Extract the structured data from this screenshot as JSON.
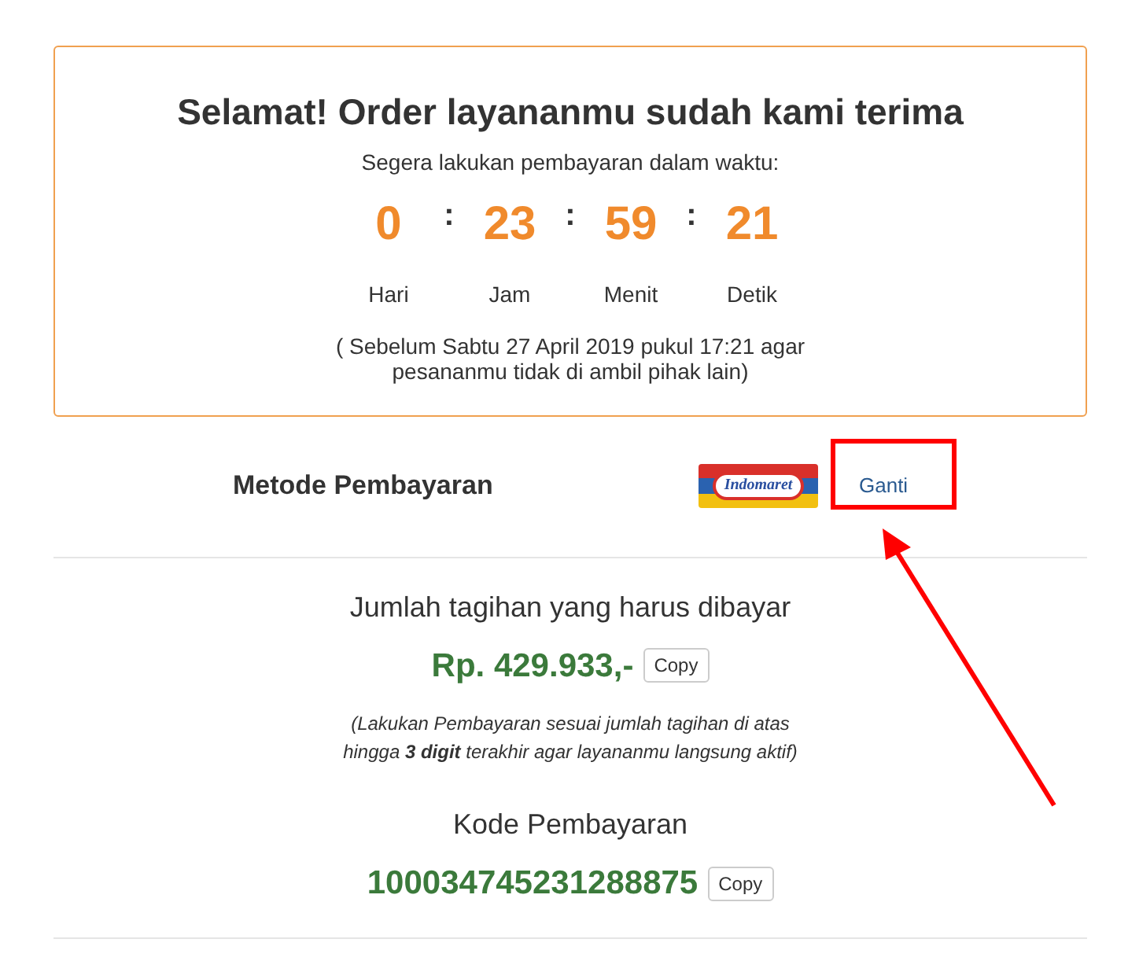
{
  "order_card": {
    "title": "Selamat! Order layananmu sudah kami terima",
    "subtitle": "Segera lakukan pembayaran dalam waktu:",
    "separator": ":",
    "countdown": [
      {
        "value": "0",
        "unit": "Hari"
      },
      {
        "value": "23",
        "unit": "Jam"
      },
      {
        "value": "59",
        "unit": "Menit"
      },
      {
        "value": "21",
        "unit": "Detik"
      }
    ],
    "deadline_note": "( Sebelum Sabtu 27 April 2019 pukul 17:21 agar pesananmu tidak di ambil pihak lain)"
  },
  "payment_method": {
    "label": "Metode Pembayaran",
    "logo_text": "Indomaret",
    "change_button": "Ganti",
    "highlighted": true
  },
  "bill": {
    "label": "Jumlah tagihan yang harus dibayar",
    "amount": "Rp. 429.933,-",
    "copy_button": "Copy",
    "note": "(Lakukan Pembayaran sesuai jumlah tagihan di atas hingga **3 digit** terakhir agar layananmu langsung aktif)"
  },
  "payment_code": {
    "label": "Kode Pembayaran",
    "code": "100034745231288875",
    "copy_button": "Copy"
  }
}
